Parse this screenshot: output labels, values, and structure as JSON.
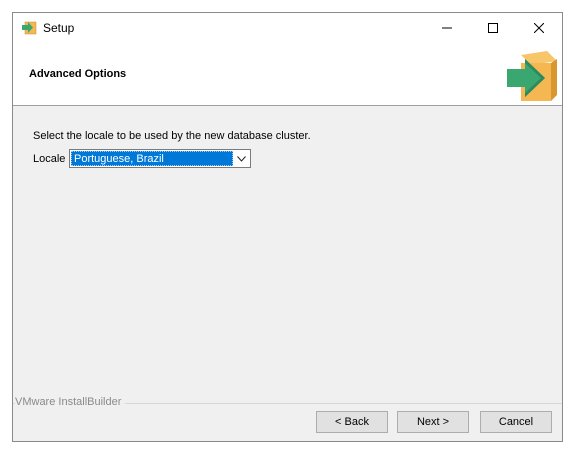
{
  "window": {
    "title": "Setup",
    "app_icon": "installer-box-icon",
    "controls": {
      "minimize": "minimize-icon",
      "maximize": "maximize-icon",
      "close": "close-icon"
    }
  },
  "header": {
    "title": "Advanced Options",
    "icon": "installer-box-arrow-icon"
  },
  "content": {
    "description": "Select the locale to be used by the new database cluster.",
    "locale_label": "Locale",
    "locale_value": "Portuguese, Brazil"
  },
  "footer": {
    "brand": "VMware InstallBuilder",
    "back_label": "< Back",
    "next_label": "Next >",
    "cancel_label": "Cancel"
  },
  "colors": {
    "selection": "#0078d7",
    "accent_green": "#3aa771",
    "box_orange": "#f4b752"
  }
}
